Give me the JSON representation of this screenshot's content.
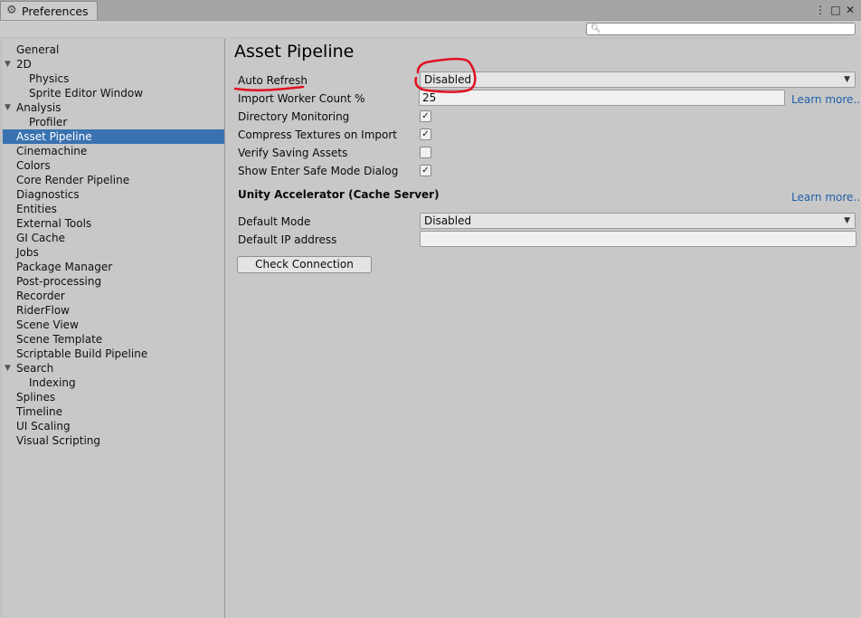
{
  "window": {
    "tab_title": "Preferences",
    "gear_icon": "gear-icon",
    "controls": {
      "menu": "⋮",
      "maximize": "□",
      "close": "✕"
    }
  },
  "search": {
    "placeholder": "",
    "icon": "search-icon"
  },
  "sidebar": {
    "items": [
      {
        "label": "General"
      },
      {
        "label": "2D"
      },
      {
        "label": "Physics"
      },
      {
        "label": "Sprite Editor Window"
      },
      {
        "label": "Analysis"
      },
      {
        "label": "Profiler"
      },
      {
        "label": "Asset Pipeline",
        "selected": true
      },
      {
        "label": "Cinemachine"
      },
      {
        "label": "Colors"
      },
      {
        "label": "Core Render Pipeline"
      },
      {
        "label": "Diagnostics"
      },
      {
        "label": "Entities"
      },
      {
        "label": "External Tools"
      },
      {
        "label": "GI Cache"
      },
      {
        "label": "Jobs"
      },
      {
        "label": "Package Manager"
      },
      {
        "label": "Post-processing"
      },
      {
        "label": "Recorder"
      },
      {
        "label": "RiderFlow"
      },
      {
        "label": "Scene View"
      },
      {
        "label": "Scene Template"
      },
      {
        "label": "Scriptable Build Pipeline"
      },
      {
        "label": "Search"
      },
      {
        "label": "Indexing"
      },
      {
        "label": "Splines"
      },
      {
        "label": "Timeline"
      },
      {
        "label": "UI Scaling"
      },
      {
        "label": "Visual Scripting"
      }
    ]
  },
  "main": {
    "title": "Asset Pipeline",
    "auto_refresh": {
      "label": "Auto Refresh",
      "value": "Disabled"
    },
    "import_worker": {
      "label": "Import Worker Count %",
      "value": "25",
      "link": "Learn more..."
    },
    "directory_monitoring": {
      "label": "Directory Monitoring",
      "checked": true
    },
    "compress_textures": {
      "label": "Compress Textures on Import",
      "checked": true
    },
    "verify_saving": {
      "label": "Verify Saving Assets",
      "checked": false
    },
    "safe_mode_dialog": {
      "label": "Show Enter Safe Mode Dialog",
      "checked": true
    },
    "accelerator": {
      "title": "Unity Accelerator (Cache Server)",
      "link": "Learn more...",
      "default_mode": {
        "label": "Default Mode",
        "value": "Disabled"
      },
      "default_ip": {
        "label": "Default IP address",
        "value": ""
      },
      "check_button": "Check Connection"
    }
  },
  "colors": {
    "selection": "#3a72b0",
    "link": "#1e5fa8",
    "annotation": "#e01020"
  }
}
